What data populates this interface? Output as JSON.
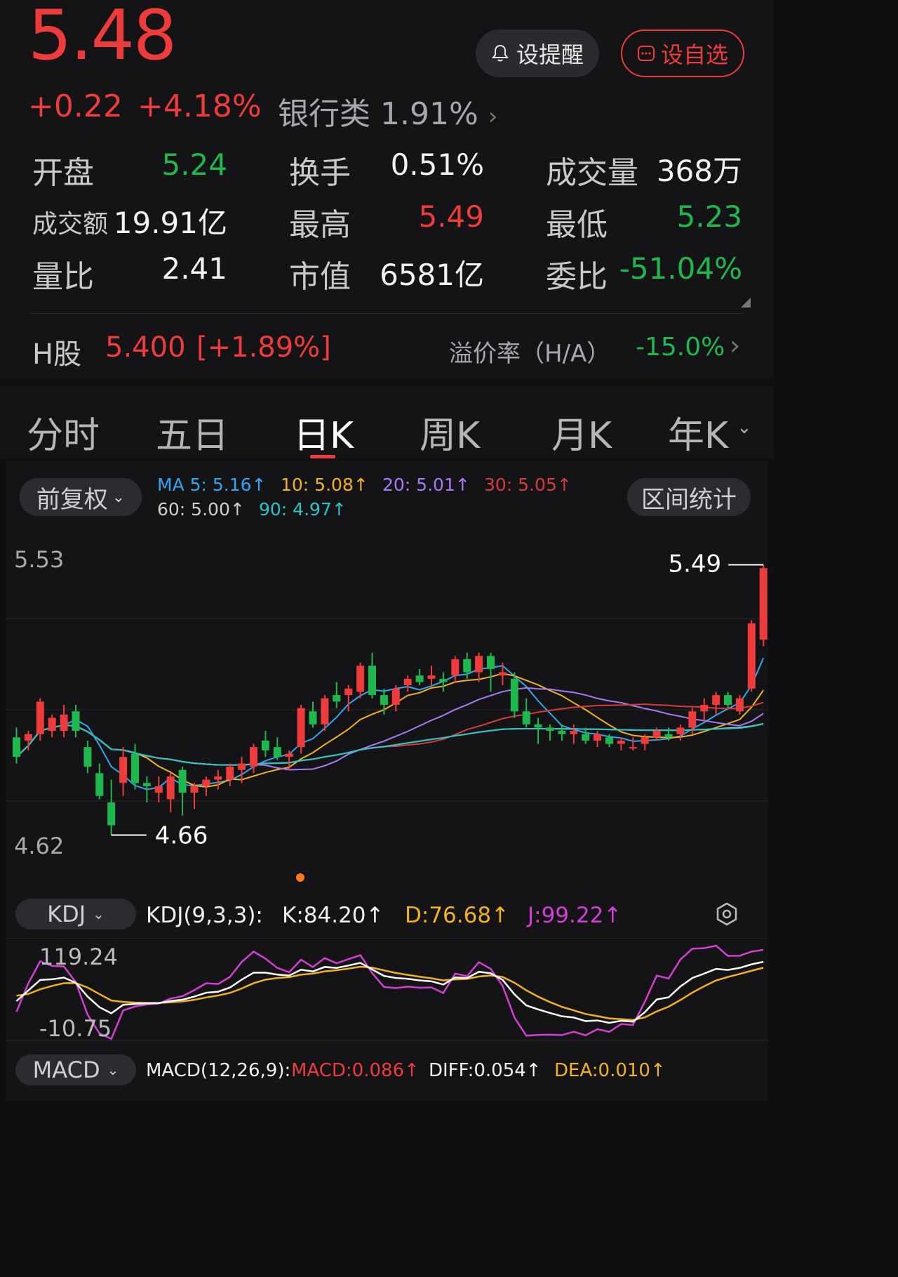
{
  "quote": {
    "price": "5.48",
    "change": "+0.22",
    "change_pct": "+4.18%",
    "sector_label": "银行类",
    "sector_pct": "1.91%",
    "chevron": "›"
  },
  "actions": {
    "alert_label": "设提醒",
    "watch_label": "设自选",
    "alert_icon": "bell-icon",
    "watch_icon": "chat-square-icon"
  },
  "stats": [
    {
      "label": "开盘",
      "value": "5.24",
      "color": "green"
    },
    {
      "label": "换手",
      "value": "0.51%",
      "color": "white"
    },
    {
      "label": "成交量",
      "value": "368万",
      "color": "white"
    },
    {
      "label": "成交额",
      "value": "19.91亿",
      "color": "white"
    },
    {
      "label": "最高",
      "value": "5.49",
      "color": "red"
    },
    {
      "label": "最低",
      "value": "5.23",
      "color": "green"
    },
    {
      "label": "量比",
      "value": "2.41",
      "color": "white"
    },
    {
      "label": "市值",
      "value": "6581亿",
      "color": "white"
    },
    {
      "label": "委比",
      "value": "-51.04%",
      "color": "green"
    }
  ],
  "hshare": {
    "label": "H股",
    "price": "5.400",
    "pct": "[+1.89%]",
    "premium_label": "溢价率（H/A）",
    "premium": "-15.0%"
  },
  "tabs": [
    "分时",
    "五日",
    "日K",
    "周K",
    "月K",
    "年K"
  ],
  "active_tab": "日K",
  "adjust": {
    "label": "前复权",
    "caret": "⌄"
  },
  "range_stats": "区间统计",
  "ma": [
    {
      "label": "MA 5: 5.16↑",
      "color": "#2fa6f0"
    },
    {
      "label": "10: 5.08↑",
      "color": "#f2b21c"
    },
    {
      "label": "20: 5.01↑",
      "color": "#a77af3"
    },
    {
      "label": "30: 5.05↑",
      "color": "#d83b3b"
    },
    {
      "label": "60: 5.00↑",
      "color": "#cfcfcf"
    },
    {
      "label": "90: 4.97↑",
      "color": "#26c6c6"
    }
  ],
  "price_axis": {
    "top": "5.53",
    "bottom": "4.62",
    "high_mark": "5.49",
    "low_mark": "4.66"
  },
  "kdj": {
    "selector": "KDJ",
    "params": "KDJ(9,3,3):",
    "k": "K:84.20↑",
    "d": "D:76.68↑",
    "j": "J:99.22↑",
    "axis_top": "119.24",
    "axis_bottom": "-10.75"
  },
  "macd": {
    "selector": "MACD",
    "params": "MACD(12,26,9):",
    "macd": "MACD:0.086↑",
    "diff": "DIFF:0.054↑",
    "dea": "DEA:0.010↑"
  },
  "colors": {
    "up": "#ee3b3b",
    "down": "#1fb84e",
    "bg": "#141416"
  },
  "chart_data": {
    "type": "candlestick",
    "ylim": [
      4.62,
      5.53
    ],
    "candles": [
      [
        4.96,
        4.99,
        4.88,
        4.9
      ],
      [
        4.95,
        4.98,
        4.92,
        4.97
      ],
      [
        4.97,
        5.08,
        4.95,
        5.07
      ],
      [
        4.98,
        5.03,
        4.96,
        5.02
      ],
      [
        4.98,
        5.06,
        4.96,
        5.03
      ],
      [
        5.04,
        5.06,
        4.96,
        4.98
      ],
      [
        4.93,
        4.95,
        4.85,
        4.87
      ],
      [
        4.85,
        4.88,
        4.77,
        4.78
      ],
      [
        4.76,
        4.83,
        4.66,
        4.69
      ],
      [
        4.82,
        4.93,
        4.78,
        4.9
      ],
      [
        4.91,
        4.94,
        4.8,
        4.82
      ],
      [
        4.82,
        4.84,
        4.76,
        4.81
      ],
      [
        4.79,
        4.84,
        4.76,
        4.81
      ],
      [
        4.77,
        4.85,
        4.73,
        4.84
      ],
      [
        4.86,
        4.87,
        4.72,
        4.79
      ],
      [
        4.79,
        4.82,
        4.74,
        4.81
      ],
      [
        4.81,
        4.84,
        4.78,
        4.83
      ],
      [
        4.83,
        4.86,
        4.8,
        4.84
      ],
      [
        4.83,
        4.88,
        4.81,
        4.87
      ],
      [
        4.86,
        4.9,
        4.82,
        4.88
      ],
      [
        4.87,
        4.94,
        4.85,
        4.93
      ],
      [
        4.95,
        4.98,
        4.9,
        4.92
      ],
      [
        4.93,
        4.96,
        4.89,
        4.9
      ],
      [
        4.9,
        4.92,
        4.86,
        4.91
      ],
      [
        4.93,
        5.06,
        4.91,
        5.05
      ],
      [
        5.04,
        5.07,
        4.99,
        5.0
      ],
      [
        5.0,
        5.09,
        4.98,
        5.08
      ],
      [
        5.09,
        5.13,
        5.05,
        5.07
      ],
      [
        5.09,
        5.12,
        5.04,
        5.11
      ],
      [
        5.1,
        5.19,
        5.08,
        5.18
      ],
      [
        5.18,
        5.22,
        5.08,
        5.09
      ],
      [
        5.09,
        5.11,
        5.03,
        5.06
      ],
      [
        5.06,
        5.12,
        5.04,
        5.11
      ],
      [
        5.12,
        5.15,
        5.1,
        5.14
      ],
      [
        5.15,
        5.17,
        5.12,
        5.13
      ],
      [
        5.14,
        5.18,
        5.12,
        5.15
      ],
      [
        5.14,
        5.16,
        5.1,
        5.13
      ],
      [
        5.15,
        5.21,
        5.13,
        5.2
      ],
      [
        5.2,
        5.22,
        5.14,
        5.16
      ],
      [
        5.16,
        5.22,
        5.13,
        5.21
      ],
      [
        5.21,
        5.22,
        5.1,
        5.17
      ],
      [
        5.15,
        5.19,
        5.12,
        5.16
      ],
      [
        5.14,
        5.16,
        5.02,
        5.04
      ],
      [
        5.04,
        5.08,
        4.99,
        5.0
      ],
      [
        5.0,
        5.02,
        4.94,
        4.99
      ],
      [
        4.99,
        5.0,
        4.95,
        4.98
      ],
      [
        4.98,
        5.0,
        4.95,
        4.97
      ],
      [
        4.97,
        5.0,
        4.94,
        4.98
      ],
      [
        4.97,
        4.99,
        4.94,
        4.95
      ],
      [
        4.95,
        4.98,
        4.93,
        4.97
      ],
      [
        4.96,
        4.97,
        4.93,
        4.94
      ],
      [
        4.94,
        4.96,
        4.92,
        4.95
      ],
      [
        4.93,
        4.96,
        4.92,
        4.93
      ],
      [
        4.94,
        4.97,
        4.92,
        4.96
      ],
      [
        4.96,
        4.99,
        4.95,
        4.98
      ],
      [
        4.97,
        4.99,
        4.95,
        4.96
      ],
      [
        4.97,
        5.0,
        4.95,
        4.99
      ],
      [
        4.99,
        5.05,
        4.97,
        5.04
      ],
      [
        5.04,
        5.08,
        5.01,
        5.06
      ],
      [
        5.06,
        5.1,
        5.03,
        5.09
      ],
      [
        5.09,
        5.1,
        5.05,
        5.06
      ],
      [
        5.04,
        5.09,
        5.03,
        5.08
      ],
      [
        5.11,
        5.32,
        5.1,
        5.31
      ],
      [
        5.26,
        5.49,
        5.24,
        5.48
      ]
    ]
  }
}
